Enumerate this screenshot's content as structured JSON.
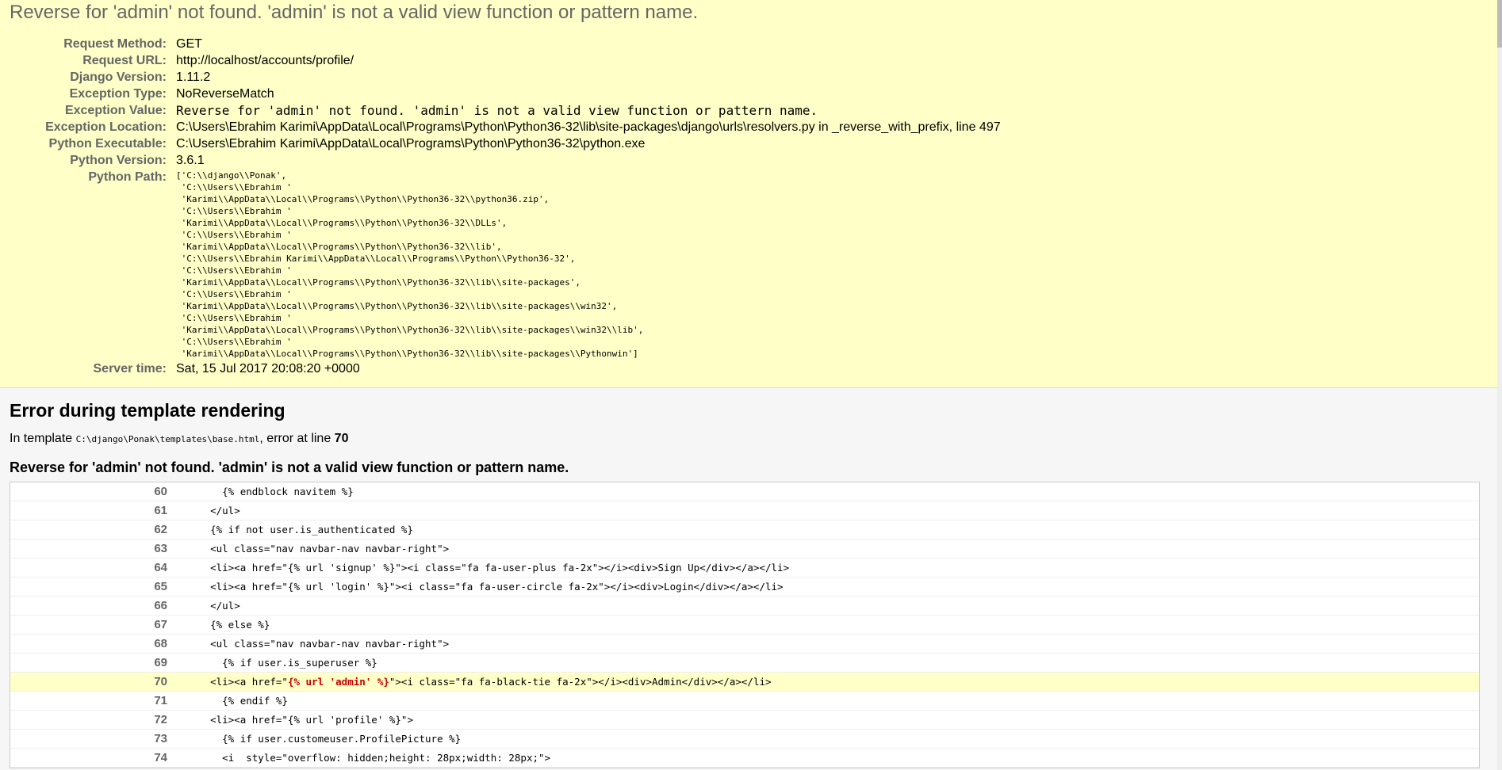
{
  "summary": {
    "title": "Reverse for 'admin' not found. 'admin' is not a valid view function or pattern name.",
    "rows": [
      {
        "label": "Request Method:",
        "value": "GET"
      },
      {
        "label": "Request URL:",
        "value": "http://localhost/accounts/profile/"
      },
      {
        "label": "Django Version:",
        "value": "1.11.2"
      },
      {
        "label": "Exception Type:",
        "value": "NoReverseMatch"
      },
      {
        "label": "Exception Value:",
        "value": "Reverse for 'admin' not found. 'admin' is not a valid view function or pattern name."
      },
      {
        "label": "Exception Location:",
        "value": "C:\\Users\\Ebrahim Karimi\\AppData\\Local\\Programs\\Python\\Python36-32\\lib\\site-packages\\django\\urls\\resolvers.py in _reverse_with_prefix, line 497"
      },
      {
        "label": "Python Executable:",
        "value": "C:\\Users\\Ebrahim Karimi\\AppData\\Local\\Programs\\Python\\Python36-32\\python.exe"
      },
      {
        "label": "Python Version:",
        "value": "3.6.1"
      },
      {
        "label": "Python Path:",
        "value": "['C:\\\\django\\\\Ponak',\n 'C:\\\\Users\\\\Ebrahim '\n 'Karimi\\\\AppData\\\\Local\\\\Programs\\\\Python\\\\Python36-32\\\\python36.zip',\n 'C:\\\\Users\\\\Ebrahim '\n 'Karimi\\\\AppData\\\\Local\\\\Programs\\\\Python\\\\Python36-32\\\\DLLs',\n 'C:\\\\Users\\\\Ebrahim '\n 'Karimi\\\\AppData\\\\Local\\\\Programs\\\\Python\\\\Python36-32\\\\lib',\n 'C:\\\\Users\\\\Ebrahim Karimi\\\\AppData\\\\Local\\\\Programs\\\\Python\\\\Python36-32',\n 'C:\\\\Users\\\\Ebrahim '\n 'Karimi\\\\AppData\\\\Local\\\\Programs\\\\Python\\\\Python36-32\\\\lib\\\\site-packages',\n 'C:\\\\Users\\\\Ebrahim '\n 'Karimi\\\\AppData\\\\Local\\\\Programs\\\\Python\\\\Python36-32\\\\lib\\\\site-packages\\\\win32',\n 'C:\\\\Users\\\\Ebrahim '\n 'Karimi\\\\AppData\\\\Local\\\\Programs\\\\Python\\\\Python36-32\\\\lib\\\\site-packages\\\\win32\\\\lib',\n 'C:\\\\Users\\\\Ebrahim '\n 'Karimi\\\\AppData\\\\Local\\\\Programs\\\\Python\\\\Python36-32\\\\lib\\\\site-packages\\\\Pythonwin']"
      },
      {
        "label": "Server time:",
        "value": "Sat, 15 Jul 2017 20:08:20 +0000"
      }
    ]
  },
  "template_error": {
    "heading": "Error during template rendering",
    "info_prefix": "In template ",
    "template_path": "C:\\django\\Ponak\\templates\\base.html",
    "info_middle": ", error at line ",
    "error_line": "70",
    "message": "Reverse for 'admin' not found. 'admin' is not a valid view function or pattern name.",
    "source_lines": [
      {
        "num": "60",
        "code": "      {% endblock navitem %}"
      },
      {
        "num": "61",
        "code": "    </ul>"
      },
      {
        "num": "62",
        "code": "    {% if not user.is_authenticated %}"
      },
      {
        "num": "63",
        "code": "    <ul class=\"nav navbar-nav navbar-right\">"
      },
      {
        "num": "64",
        "code": "    <li><a href=\"{% url 'signup' %}\"><i class=\"fa fa-user-plus fa-2x\"></i><div>Sign Up</div></a></li>"
      },
      {
        "num": "65",
        "code": "    <li><a href=\"{% url 'login' %}\"><i class=\"fa fa-user-circle fa-2x\"></i><div>Login</div></a></li>"
      },
      {
        "num": "66",
        "code": "    </ul>"
      },
      {
        "num": "67",
        "code": "    {% else %}"
      },
      {
        "num": "68",
        "code": "    <ul class=\"nav navbar-nav navbar-right\">"
      },
      {
        "num": "69",
        "code": "      {% if user.is_superuser %}"
      },
      {
        "num": "70",
        "pre": "    <li><a href=\"",
        "err": "{% url 'admin' %}",
        "post": "\"><i class=\"fa fa-black-tie fa-2x\"></i><div>Admin</div></a></li>",
        "highlight": true
      },
      {
        "num": "71",
        "code": "      {% endif %}"
      },
      {
        "num": "72",
        "code": "    <li><a href=\"{% url 'profile' %}\">"
      },
      {
        "num": "73",
        "code": "      {% if user.customeuser.ProfilePicture %}"
      },
      {
        "num": "74",
        "code": "      <i  style=\"overflow: hidden;height: 28px;width: 28px;\">"
      }
    ]
  }
}
